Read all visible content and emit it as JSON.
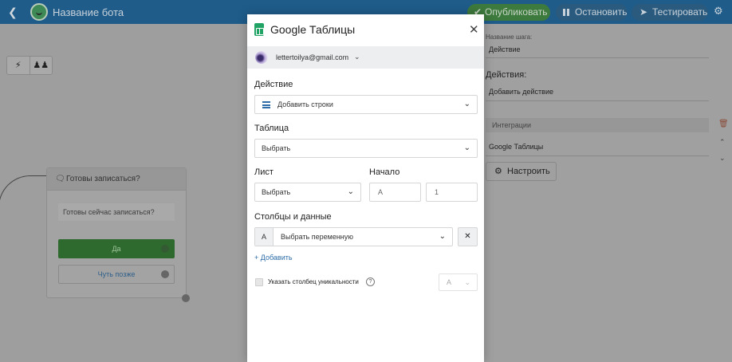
{
  "topbar": {
    "back_icon": "chevron-left-icon",
    "bot_name": "Название бота",
    "publish_label": "Опубликовать",
    "stop_label": "Остановить",
    "test_label": "Тестировать",
    "settings_icon": "gear-icon"
  },
  "canvas": {
    "node": {
      "title": "Готовы записаться?",
      "message": "Готовы сейчас записаться?",
      "button_yes": "Да",
      "button_later": "Чуть позже"
    }
  },
  "sidepanel": {
    "step_name_label": "Название шага:",
    "step_name_value": "Действие",
    "actions_heading": "Действия:",
    "add_action": "Добавить действие",
    "integrations_label": "Интеграции",
    "integration_value": "Google Таблицы",
    "configure_label": "Настроить"
  },
  "modal": {
    "title": "Google Таблицы",
    "account_email": "lettertoilya@gmail.com",
    "action_label": "Действие",
    "action_value": "Добавить строки",
    "table_label": "Таблица",
    "table_value": "Выбрать",
    "sheet_label": "Лист",
    "sheet_value": "Выбрать",
    "start_label": "Начало",
    "start_col_placeholder": "A",
    "start_row_placeholder": "1",
    "columns_label": "Столбцы и данные",
    "column_tag": "A",
    "column_var_value": "Выбрать переменную",
    "add_label": "+ Добавить",
    "unique_label": "Указать столбец уникальности",
    "unique_col_value": "A"
  },
  "colors": {
    "modal_bg": "#ffffff",
    "account_bg": "#eceef0",
    "accent_blue": "#2f6ea8",
    "sheets_green": "#21a366",
    "overlay_gray": "#9e9e9e"
  }
}
